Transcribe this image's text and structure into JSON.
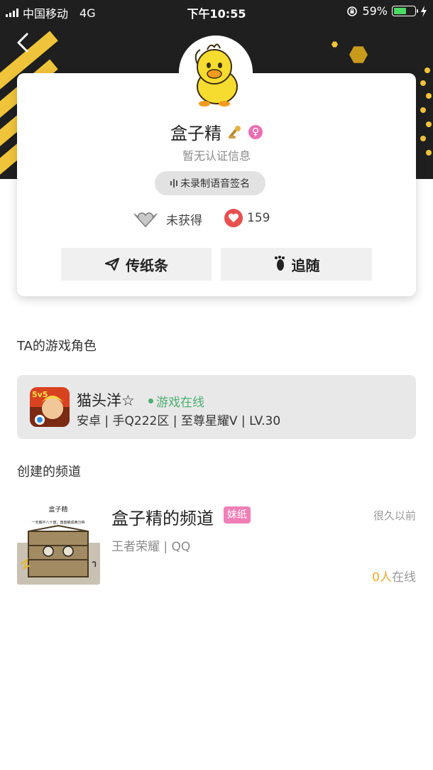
{
  "status_bar": {
    "carrier": "中国移动",
    "network": "4G",
    "time": "下午10:55",
    "battery": "59%",
    "battery_level": 0.59
  },
  "profile": {
    "nickname": "盒子精",
    "gender_symbol": "♀",
    "certification": "暂无认证信息",
    "voice_signature": "未录制语音签名",
    "honor_label": "未获得",
    "likes": "159",
    "note_button": "传纸条",
    "follow_button": "追随"
  },
  "game_roles": {
    "title": "TA的游戏角色",
    "role_name": "猫头洋☆",
    "status": "游戏在线",
    "detail": "安卓 | 手Q222区 | 至尊星耀V | LV.30",
    "icon_text": "5v5"
  },
  "channels": {
    "title": "创建的频道",
    "name": "盒子精的频道",
    "tag": "妹纸",
    "time": "很久以前",
    "game": "王者荣耀 | QQ",
    "online_count": "0人",
    "online_label": "在线",
    "thumb_title": "盒子精",
    "thumb_subtitle": "一天躺平八十盘，盘盘躺成两分钟"
  },
  "colors": {
    "accent_yellow": "#f0c43a",
    "online_green": "#4caf72",
    "like_red": "#e8504f",
    "tag_pink": "#f07fb6"
  }
}
